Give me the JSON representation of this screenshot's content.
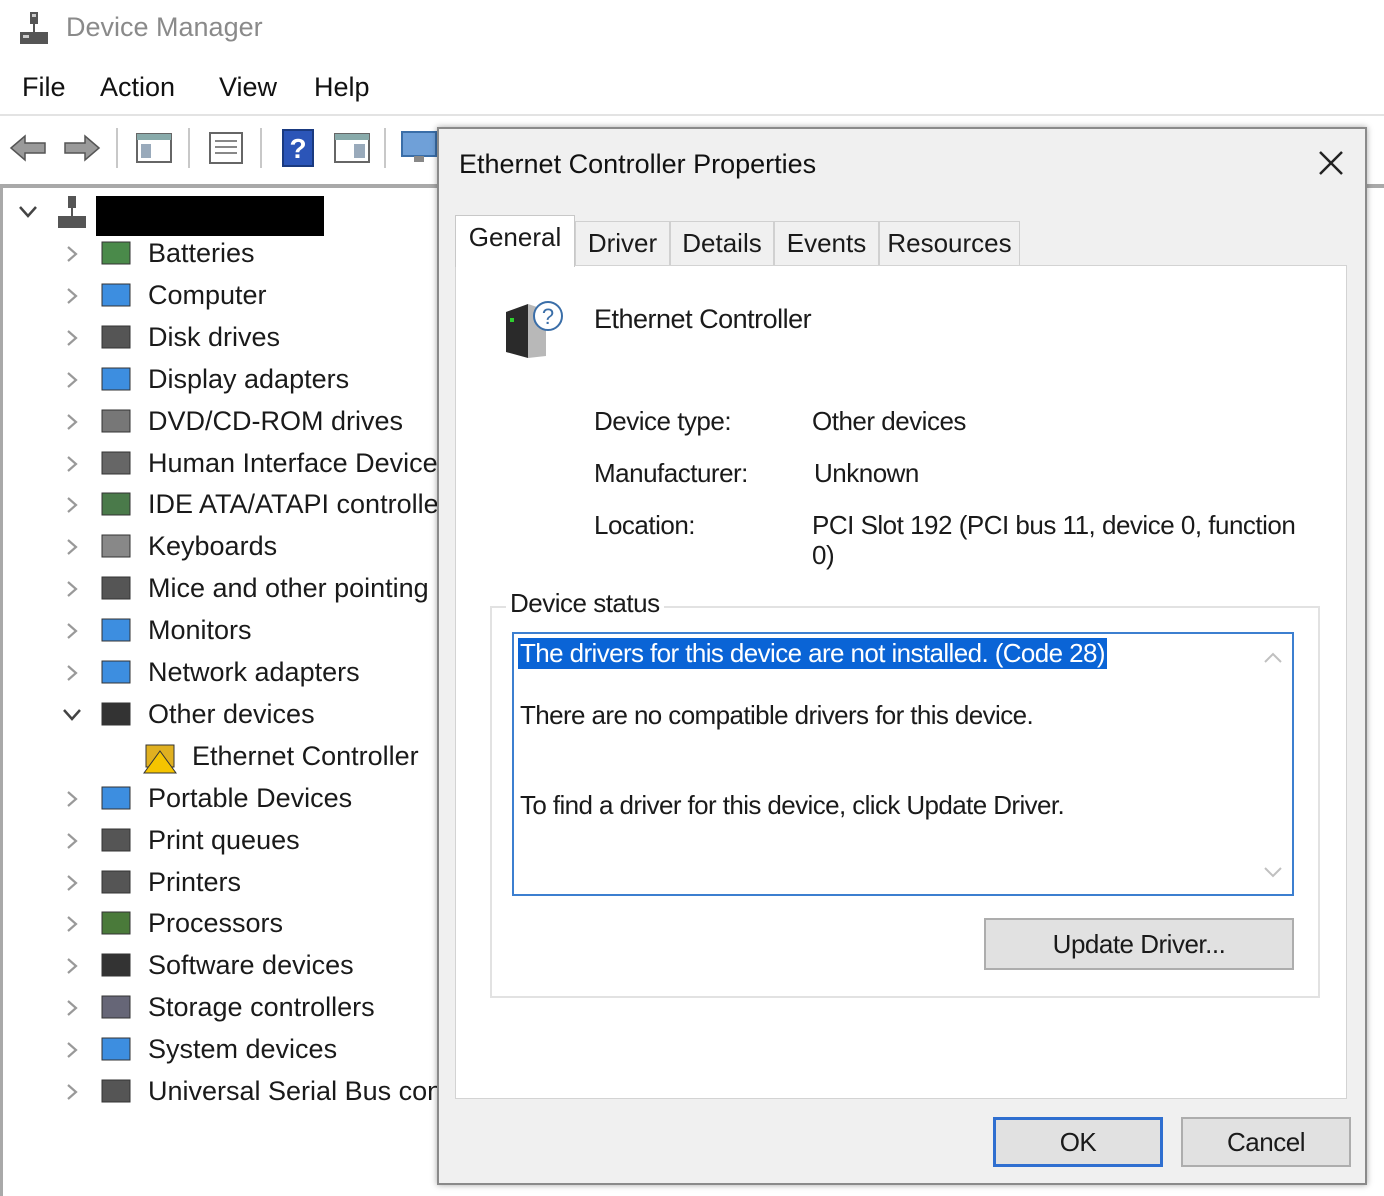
{
  "app": {
    "title": "Device Manager"
  },
  "menu": [
    "File",
    "Action",
    "View",
    "Help"
  ],
  "toolbar": {
    "icons": [
      "back-arrow-icon",
      "forward-arrow-icon",
      "show-hide-console-tree-icon",
      "properties-icon",
      "help-icon",
      "action-pane-icon",
      "scan-hardware-icon"
    ]
  },
  "tree": {
    "items": [
      {
        "label": "Batteries",
        "icon": "battery-icon",
        "expanded": false
      },
      {
        "label": "Computer",
        "icon": "monitor-icon",
        "expanded": false
      },
      {
        "label": "Disk drives",
        "icon": "disk-drive-icon",
        "expanded": false
      },
      {
        "label": "Display adapters",
        "icon": "display-adapter-icon",
        "expanded": false
      },
      {
        "label": "DVD/CD-ROM drives",
        "icon": "dvd-drive-icon",
        "expanded": false
      },
      {
        "label": "Human Interface Devices",
        "icon": "hid-icon",
        "expanded": false
      },
      {
        "label": "IDE ATA/ATAPI controllers",
        "icon": "ide-controller-icon",
        "expanded": false
      },
      {
        "label": "Keyboards",
        "icon": "keyboard-icon",
        "expanded": false
      },
      {
        "label": "Mice and other pointing devices",
        "icon": "mouse-icon",
        "expanded": false
      },
      {
        "label": "Monitors",
        "icon": "monitor-icon",
        "expanded": false
      },
      {
        "label": "Network adapters",
        "icon": "network-adapter-icon",
        "expanded": false
      },
      {
        "label": "Other devices",
        "icon": "unknown-device-icon",
        "expanded": true
      },
      {
        "label": "Ethernet Controller",
        "icon": "warning-device-icon",
        "child": true
      },
      {
        "label": "Portable Devices",
        "icon": "portable-device-icon",
        "expanded": false
      },
      {
        "label": "Print queues",
        "icon": "printer-icon",
        "expanded": false
      },
      {
        "label": "Printers",
        "icon": "printer-icon",
        "expanded": false
      },
      {
        "label": "Processors",
        "icon": "processor-icon",
        "expanded": false
      },
      {
        "label": "Software devices",
        "icon": "software-device-icon",
        "expanded": false
      },
      {
        "label": "Storage controllers",
        "icon": "storage-controller-icon",
        "expanded": false
      },
      {
        "label": "System devices",
        "icon": "system-folder-icon",
        "expanded": false
      },
      {
        "label": "Universal Serial Bus controllers",
        "icon": "usb-icon",
        "expanded": false
      }
    ]
  },
  "dialog": {
    "title": "Ethernet Controller Properties",
    "tabs": [
      "General",
      "Driver",
      "Details",
      "Events",
      "Resources"
    ],
    "active_tab": "General",
    "device_name": "Ethernet Controller",
    "props": {
      "type_label": "Device type:",
      "type_value": "Other devices",
      "manufacturer_label": "Manufacturer:",
      "manufacturer_value": "Unknown",
      "location_label": "Location:",
      "location_value": "PCI Slot 192 (PCI bus 11, device 0, function 0)"
    },
    "status_legend": "Device status",
    "status_lines": [
      "The drivers for this device are not installed. (Code 28)",
      "There are no compatible drivers for this device.",
      "To find a driver for this device, click Update Driver."
    ],
    "update_driver_label": "Update Driver...",
    "ok_label": "OK",
    "cancel_label": "Cancel"
  }
}
